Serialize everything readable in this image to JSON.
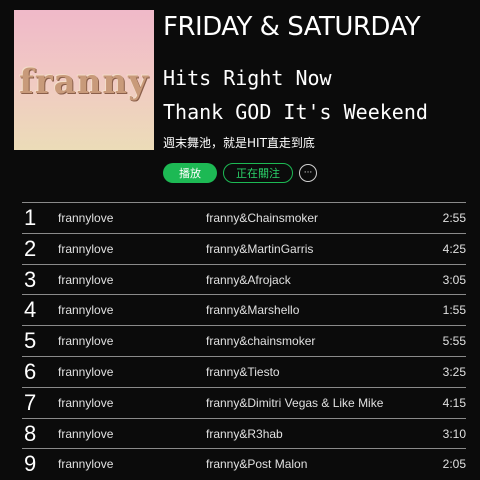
{
  "playlist": {
    "cover_text": "franny",
    "title": "FRIDAY & SATURDAY",
    "description_line1": "Hits Right Now",
    "description_line2": "Thank GOD It's Weekend",
    "description_cn": "週末舞池，就是HIT直走到底",
    "play_label": "播放",
    "follow_label": "正在關注",
    "more_label": "···"
  },
  "tracks": [
    {
      "num": "1",
      "artist": "frannylove",
      "title": "franny&Chainsmoker",
      "duration": "2:55"
    },
    {
      "num": "2",
      "artist": "frannylove",
      "title": "franny&MartinGarris",
      "duration": "4:25"
    },
    {
      "num": "3",
      "artist": "frannylove",
      "title": "franny&Afrojack",
      "duration": "3:05"
    },
    {
      "num": "4",
      "artist": "frannylove",
      "title": "franny&Marshello",
      "duration": "1:55"
    },
    {
      "num": "5",
      "artist": "frannylove",
      "title": "franny&chainsmoker",
      "duration": "5:55"
    },
    {
      "num": "6",
      "artist": "frannylove",
      "title": "franny&Tiesto",
      "duration": "3:25"
    },
    {
      "num": "7",
      "artist": "frannylove",
      "title": "franny&Dimitri Vegas & Like Mike",
      "duration": "4:15"
    },
    {
      "num": "8",
      "artist": "frannylove",
      "title": "franny&R3hab",
      "duration": "3:10"
    },
    {
      "num": "9",
      "artist": "frannylove",
      "title": "franny&Post  Malon",
      "duration": "2:05"
    }
  ],
  "colors": {
    "accent": "#1db954",
    "background": "#0b0b0b"
  }
}
